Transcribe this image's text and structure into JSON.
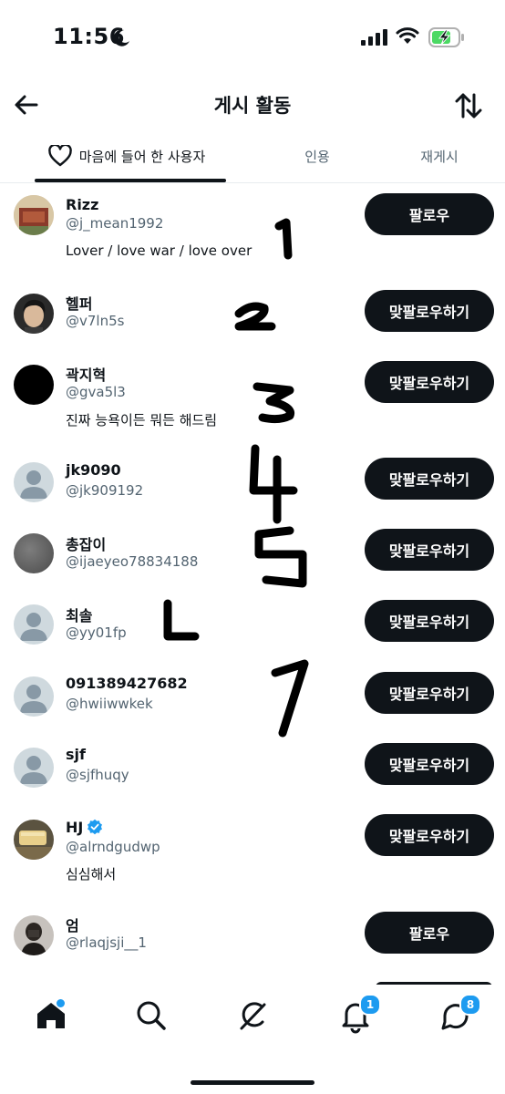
{
  "status_bar": {
    "time": "11:56"
  },
  "header": {
    "title": "게시 활동"
  },
  "tabs": [
    {
      "label": "마음에 들어 한 사용자",
      "active": true
    },
    {
      "label": "인용",
      "active": false
    },
    {
      "label": "재게시",
      "active": false
    }
  ],
  "users": [
    {
      "name": "Rizz",
      "handle": "@j_mean1992",
      "bio": "Lover / love war / love over",
      "button": "팔로우"
    },
    {
      "name": "헬퍼",
      "handle": "@v7ln5s",
      "bio": "",
      "button": "맞팔로우하기"
    },
    {
      "name": "곽지혁",
      "handle": "@gva5l3",
      "bio": "진짜 능욕이든 뭐든 해드림",
      "button": "맞팔로우하기"
    },
    {
      "name": "jk9090",
      "handle": "@jk909192",
      "bio": "",
      "button": "맞팔로우하기"
    },
    {
      "name": "총잡이",
      "handle": "@ijaeyeo78834188",
      "bio": "",
      "button": "맞팔로우하기"
    },
    {
      "name": "최솔",
      "handle": "@yy01fp",
      "bio": "",
      "button": "맞팔로우하기"
    },
    {
      "name": "091389427682",
      "handle": "@hwiiwwkek",
      "bio": "",
      "button": "맞팔로우하기"
    },
    {
      "name": "sjf",
      "handle": "@sjfhuqy",
      "bio": "",
      "button": "맞팔로우하기"
    },
    {
      "name": "HJ",
      "handle": "@alrndgudwp",
      "bio": "심심해서",
      "button": "맞팔로우하기",
      "verified": true
    },
    {
      "name": "엄",
      "handle": "@rlaqjsji__1",
      "bio": "",
      "button": "팔로우"
    }
  ],
  "bottom_nav": {
    "notifications_badge": "1",
    "messages_badge": "8"
  },
  "colors": {
    "accent": "#1d9bf0",
    "button_bg": "#0f1419",
    "secondary_text": "#536471"
  },
  "icons": [
    "back-arrow-icon",
    "sort-icon",
    "heart-icon",
    "home-icon",
    "search-icon",
    "grok-icon",
    "bell-icon",
    "messages-icon",
    "verified-icon"
  ]
}
